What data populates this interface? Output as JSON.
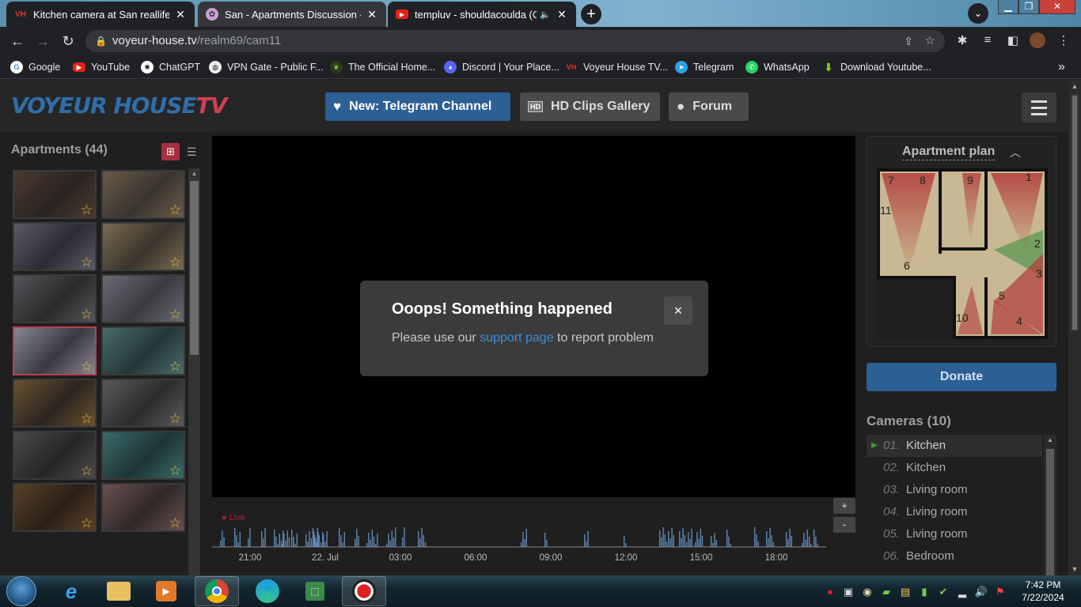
{
  "browser": {
    "tabs": [
      {
        "title": "Kitchen camera at San reallifecam",
        "active": false,
        "favicon": "vh-tv-icon"
      },
      {
        "title": "San - Apartments Discussion - Vo",
        "active": true,
        "favicon": "forum-icon"
      },
      {
        "title": "templuv - shouldacoulda (Of",
        "active": false,
        "favicon": "youtube-icon",
        "audio": true
      }
    ],
    "url_host": "voyeur-house.tv",
    "url_path": "/realm69/cam11",
    "bookmarks": [
      "Google",
      "YouTube",
      "ChatGPT",
      "VPN Gate - Public F...",
      "The Official Home...",
      "Discord | Your Place...",
      "Voyeur House TV...",
      "Telegram",
      "WhatsApp",
      "Download Youtube..."
    ],
    "bookmarks_overflow": "»"
  },
  "site": {
    "logo_main": "VOYEUR HOUSE",
    "logo_tv": "TV",
    "nav": [
      {
        "label": "New: Telegram Channel",
        "icon": "heart-icon",
        "color": "#2c5f94"
      },
      {
        "label": "HD Clips Gallery",
        "icon": "hd-icon",
        "color": "#4a4a4a"
      },
      {
        "label": "Forum",
        "icon": "chat-bubble-icon",
        "color": "#4a4a4a"
      }
    ],
    "hd_badge": "HD"
  },
  "sidebar": {
    "title": "Apartments (44)",
    "thumb_count_visible": 14,
    "selected_index": 6
  },
  "error_modal": {
    "title": "Ooops! Something happened",
    "text_before": "Please use our ",
    "link": "support page",
    "text_after": " to report problem",
    "close": "×"
  },
  "timeline": {
    "live_label": "Live",
    "ticks": [
      "21:00",
      "22. Jul",
      "03:00",
      "06:00",
      "09:00",
      "12:00",
      "15:00",
      "18:00"
    ],
    "zoom_in": "+",
    "zoom_out": "-"
  },
  "apartment_plan": {
    "title": "Apartment plan",
    "camera_numbers": [
      "7",
      "8",
      "9",
      "1",
      "11",
      "2",
      "6",
      "3",
      "5",
      "10",
      "4"
    ]
  },
  "donate": "Donate",
  "cameras": {
    "title": "Cameras (10)",
    "items": [
      {
        "num": "01.",
        "name": "Kitchen",
        "active": true
      },
      {
        "num": "02.",
        "name": "Kitchen"
      },
      {
        "num": "03.",
        "name": "Living room"
      },
      {
        "num": "04.",
        "name": "Living room"
      },
      {
        "num": "05.",
        "name": "Living room"
      },
      {
        "num": "06.",
        "name": "Bedroom"
      }
    ]
  },
  "taskbar": {
    "time": "7:42 PM",
    "date": "7/22/2024"
  },
  "colors": {
    "accent_blue": "#2c5f94",
    "accent_red": "#c03c4c",
    "star": "#e8c03a"
  }
}
